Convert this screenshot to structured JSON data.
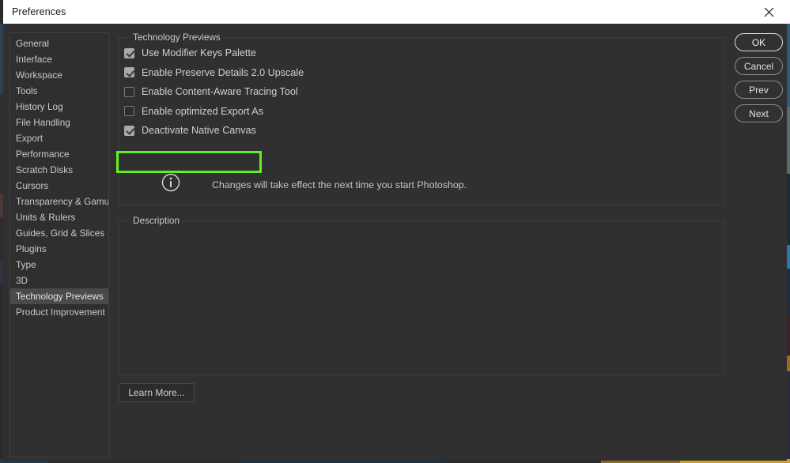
{
  "window": {
    "title": "Preferences",
    "close_icon": "close-icon"
  },
  "sidebar": {
    "items": [
      {
        "label": "General",
        "selected": false
      },
      {
        "label": "Interface",
        "selected": false
      },
      {
        "label": "Workspace",
        "selected": false
      },
      {
        "label": "Tools",
        "selected": false
      },
      {
        "label": "History Log",
        "selected": false
      },
      {
        "label": "File Handling",
        "selected": false
      },
      {
        "label": "Export",
        "selected": false
      },
      {
        "label": "Performance",
        "selected": false
      },
      {
        "label": "Scratch Disks",
        "selected": false
      },
      {
        "label": "Cursors",
        "selected": false
      },
      {
        "label": "Transparency & Gamut",
        "selected": false
      },
      {
        "label": "Units & Rulers",
        "selected": false
      },
      {
        "label": "Guides, Grid & Slices",
        "selected": false
      },
      {
        "label": "Plugins",
        "selected": false
      },
      {
        "label": "Type",
        "selected": false
      },
      {
        "label": "3D",
        "selected": false
      },
      {
        "label": "Technology Previews",
        "selected": true
      },
      {
        "label": "Product Improvement",
        "selected": false
      }
    ]
  },
  "tech_previews": {
    "legend": "Technology Previews",
    "options": [
      {
        "label": "Use Modifier Keys Palette",
        "checked": true,
        "highlighted": false
      },
      {
        "label": "Enable Preserve Details 2.0 Upscale",
        "checked": true,
        "highlighted": false
      },
      {
        "label": "Enable Content-Aware Tracing Tool",
        "checked": false,
        "highlighted": false
      },
      {
        "label": "Enable optimized Export As",
        "checked": false,
        "highlighted": false
      },
      {
        "label": "Deactivate Native Canvas",
        "checked": true,
        "highlighted": true
      }
    ],
    "note": {
      "icon": "info-icon",
      "text": "Changes will take effect the next time you start Photoshop."
    },
    "highlight_color": "#5ff020"
  },
  "description": {
    "legend": "Description",
    "body": ""
  },
  "learn_more": {
    "label": "Learn More..."
  },
  "actions": {
    "buttons": [
      {
        "label": "OK",
        "primary": true
      },
      {
        "label": "Cancel",
        "primary": false
      },
      {
        "label": "Prev",
        "primary": false
      },
      {
        "label": "Next",
        "primary": false
      }
    ]
  }
}
